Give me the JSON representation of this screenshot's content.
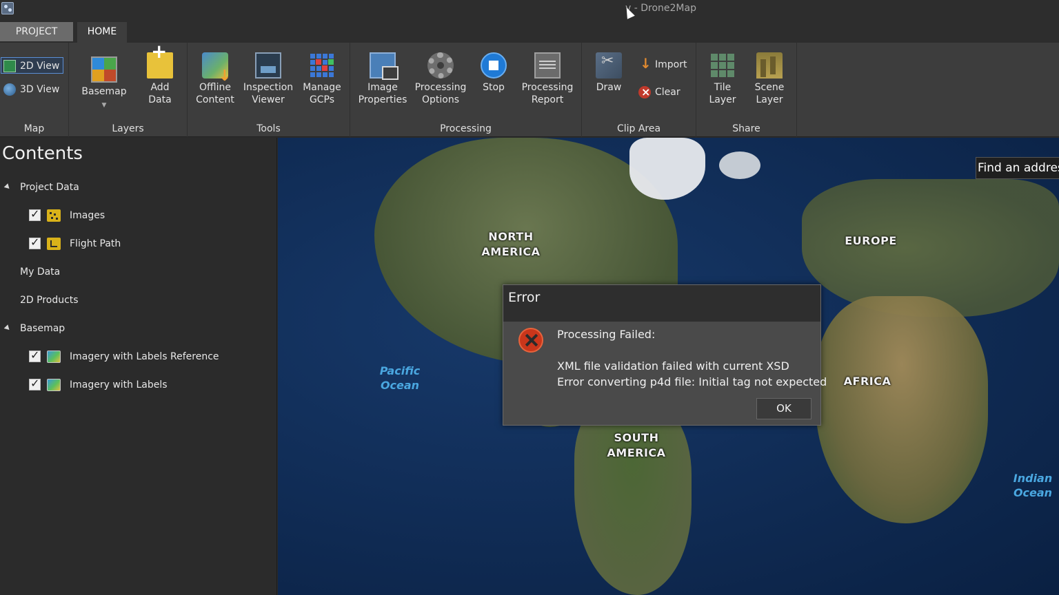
{
  "window": {
    "title": "v - Drone2Map"
  },
  "tabs": {
    "project": "PROJECT",
    "home": "HOME"
  },
  "ribbon": {
    "map": {
      "label": "Map",
      "view2d": "2D View",
      "view3d": "3D View"
    },
    "layers": {
      "label": "Layers",
      "basemap": "Basemap",
      "add_data": "Add\nData"
    },
    "tools": {
      "label": "Tools",
      "offline_content": "Offline\nContent",
      "inspection_viewer": "Inspection\nViewer",
      "manage_gcps": "Manage\nGCPs"
    },
    "processing": {
      "label": "Processing",
      "image_properties": "Image\nProperties",
      "processing_options": "Processing\nOptions",
      "stop": "Stop",
      "processing_report": "Processing\nReport"
    },
    "clip_area": {
      "label": "Clip Area",
      "draw": "Draw",
      "import": "Import",
      "clear": "Clear"
    },
    "share": {
      "label": "Share",
      "tile_layer": "Tile\nLayer",
      "scene_layer": "Scene\nLayer"
    }
  },
  "contents": {
    "title": "Contents",
    "project_data": "Project Data",
    "images": "Images",
    "flight_path": "Flight Path",
    "my_data": "My Data",
    "products_2d": "2D Products",
    "basemap": "Basemap",
    "imagery_labels_reference": "Imagery with Labels Reference",
    "imagery_labels": "Imagery with Labels"
  },
  "map": {
    "find_address": "Find an address",
    "north_america": "NORTH\nAMERICA",
    "south_america": "SOUTH\nAMERICA",
    "europe": "EUROPE",
    "africa": "AFRICA",
    "pacific_ocean": "Pacific\nOcean",
    "indian_ocean": "Indian\nOcean"
  },
  "dialog": {
    "title": "Error",
    "line1": "Processing Failed:",
    "line2": "XML file validation failed with current XSD",
    "line3": "Error converting p4d file: Initial tag not expected",
    "ok": "OK"
  }
}
